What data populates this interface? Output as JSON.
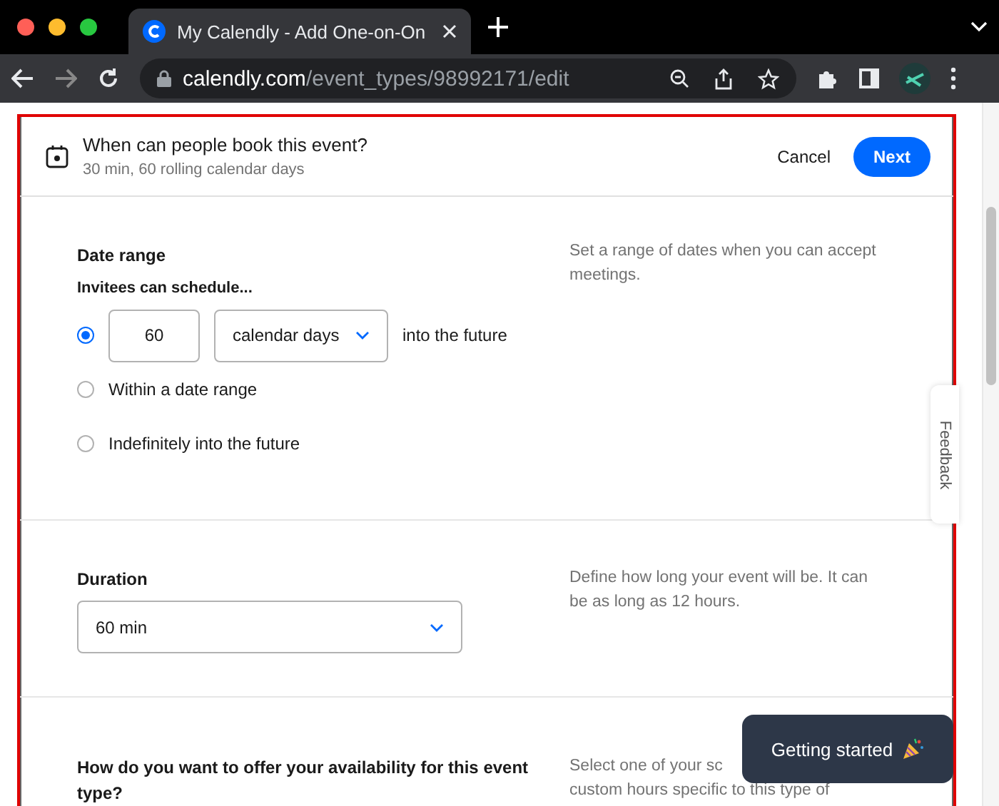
{
  "browser": {
    "tab_title": "My Calendly - Add One-on-On",
    "url_host": "calendly.com",
    "url_path": "/event_types/98992171/edit"
  },
  "header": {
    "title": "When can people book this event?",
    "subtitle": "30 min, 60 rolling calendar days",
    "cancel": "Cancel",
    "next": "Next"
  },
  "date_range": {
    "heading": "Date range",
    "sublabel": "Invitees can schedule...",
    "description": "Set a range of dates when you can accept meetings.",
    "options": [
      {
        "kind": "rolling",
        "selected": true,
        "value": "60",
        "unit": "calendar days",
        "suffix": "into the future"
      },
      {
        "kind": "plain",
        "selected": false,
        "label": "Within a date range"
      },
      {
        "kind": "plain",
        "selected": false,
        "label": "Indefinitely into the future"
      }
    ]
  },
  "duration": {
    "heading": "Duration",
    "value": "60 min",
    "description": "Define how long your event will be. It can be as long as 12 hours."
  },
  "availability": {
    "heading": "How do you want to offer your availability for this event type?",
    "description_lines": [
      "Select one of your sc",
      "custom hours specific to this type of"
    ]
  },
  "feedback": "Feedback",
  "toast": "Getting started"
}
